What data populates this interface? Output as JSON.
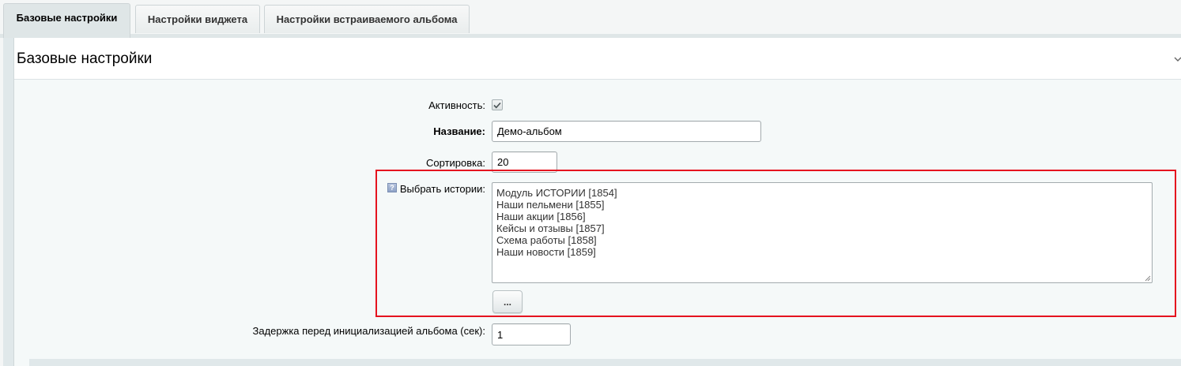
{
  "tabs": [
    {
      "label": "Базовые настройки",
      "active": true
    },
    {
      "label": "Настройки виджета",
      "active": false
    },
    {
      "label": "Настройки встраиваемого альбома",
      "active": false
    }
  ],
  "section": {
    "title": "Базовые настройки"
  },
  "form": {
    "activity": {
      "label": "Активность:",
      "checked": true
    },
    "name": {
      "label": "Название:",
      "value": "Демо-альбом"
    },
    "sort": {
      "label": "Сортировка:",
      "value": "20"
    },
    "stories": {
      "label": "Выбрать истории:",
      "help_icon": "question-icon",
      "items": [
        "Модуль ИСТОРИИ [1854]",
        "Наши пельмени [1855]",
        "Наши акции [1856]",
        "Кейсы и отзывы [1857]",
        "Схема работы [1858]",
        "Наши новости [1859]"
      ],
      "browse_button": "..."
    },
    "delay": {
      "label": "Задержка перед инициализацией альбома (сек):",
      "value": "1"
    }
  },
  "colors": {
    "highlight_border": "#e5131f",
    "panel_background": "#f5f9f9",
    "tab_active": "#dfe6e7"
  }
}
